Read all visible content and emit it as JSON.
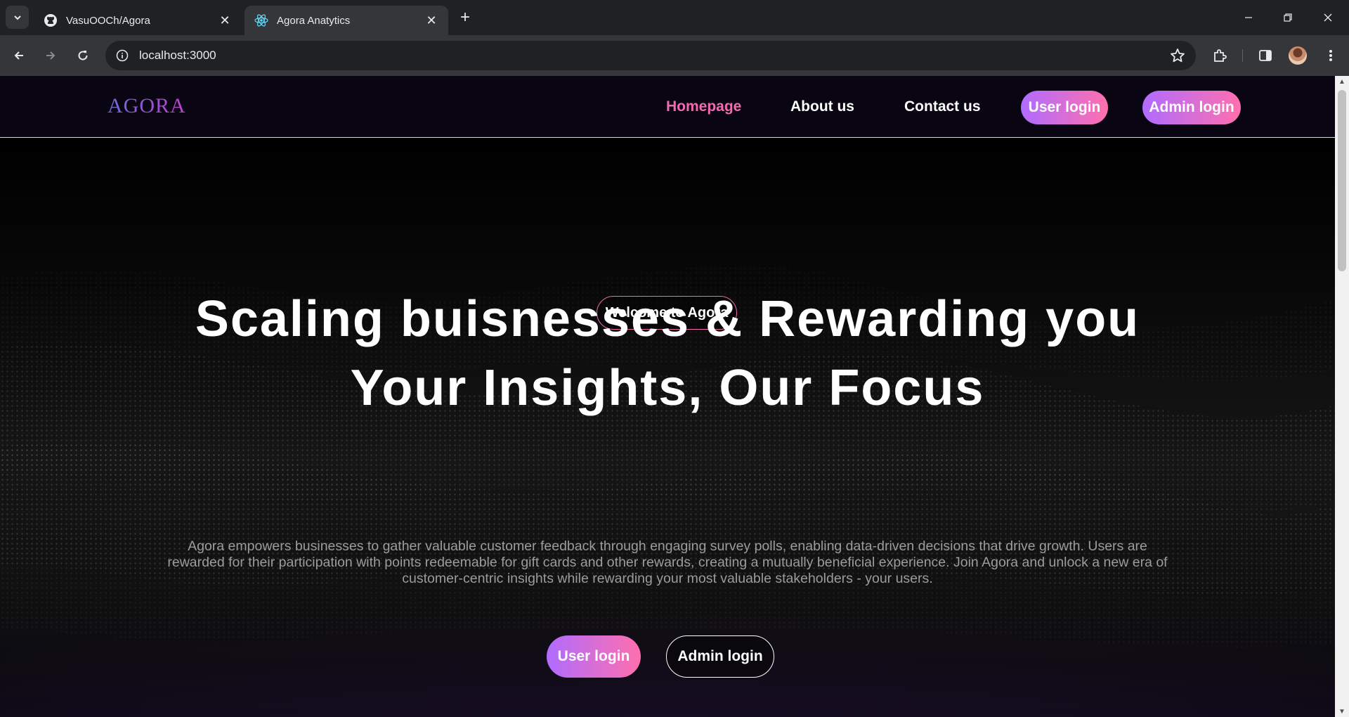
{
  "browser": {
    "tabs": [
      {
        "title": "VasuOOCh/Agora",
        "favicon": "github-icon",
        "active": false
      },
      {
        "title": "Agora Anatytics",
        "favicon": "react-icon",
        "active": true
      }
    ],
    "url": "localhost:3000"
  },
  "site": {
    "logo": "AGORA",
    "nav": {
      "homepage": "Homepage",
      "about": "About us",
      "contact": "Contact us",
      "user_login": "User login",
      "admin_login": "Admin login"
    },
    "hero": {
      "badge": "Welcome to Agora",
      "headline_line1": "Scaling buisnesses & Rewarding you",
      "headline_line2": "Your Insights, Our Focus",
      "description_line1": "Agora empowers businesses to gather valuable customer feedback through engaging survey polls, enabling data-driven decisions that drive growth. Users are",
      "description_line2": "rewarded for their participation with points redeemable for gift cards and other rewards, creating a mutually beneficial experience. Join Agora and unlock a new era of",
      "description_line3": "customer-centric insights while rewarding your most valuable stakeholders - your users.",
      "cta_user": "User login",
      "cta_admin": "Admin login"
    }
  },
  "colors": {
    "accent_pink": "#f36ab0",
    "gradient_start": "#b06cff",
    "gradient_end": "#ff6fae"
  }
}
